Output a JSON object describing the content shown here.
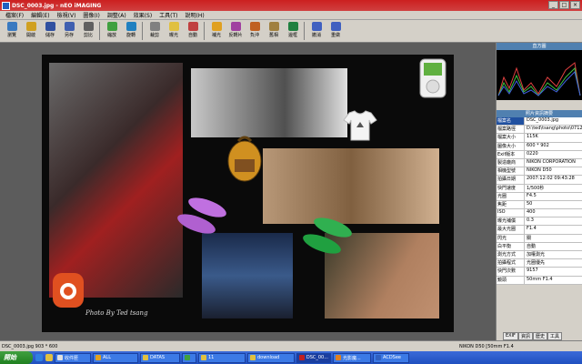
{
  "window": {
    "title": "DSC_0003.jpg - nEO iMAGING"
  },
  "menu": [
    "檔案(F)",
    "編輯(E)",
    "檢視(V)",
    "圖像(I)",
    "調整(A)",
    "效果(S)",
    "工具(T)",
    "說明(H)"
  ],
  "toolbar": [
    {
      "label": "瀏覽",
      "color": "#3a7ac0"
    },
    {
      "label": "開啟",
      "color": "#d0a020"
    },
    {
      "label": "儲存",
      "color": "#3050a0"
    },
    {
      "label": "另存",
      "color": "#4060b0"
    },
    {
      "label": "剪比",
      "color": "#606060"
    },
    {
      "label": "縮放",
      "color": "#40a040"
    },
    {
      "label": "旋轉",
      "color": "#2080c0"
    },
    {
      "label": "裁剪",
      "color": "#808080"
    },
    {
      "label": "曝光",
      "color": "#e0c040"
    },
    {
      "label": "自動",
      "color": "#c04040"
    },
    {
      "label": "補光",
      "color": "#e0a020"
    },
    {
      "label": "反轉片",
      "color": "#a040a0"
    },
    {
      "label": "負沖",
      "color": "#c06020"
    },
    {
      "label": "舊相",
      "color": "#a08040"
    },
    {
      "label": "邊框",
      "color": "#208040"
    },
    {
      "label": "撤消",
      "color": "#4060c0"
    },
    {
      "label": "重做",
      "color": "#4060c0"
    }
  ],
  "canvas": {
    "photo_credit": "Photo By Ted tsang"
  },
  "panel": {
    "histogram_title": "直方圖",
    "info_title": "照片資訊摘要",
    "rows": [
      [
        "檔案名",
        "DSC_0003.jpg"
      ],
      [
        "檔案路徑",
        "D:\\ted\\tsang\\photo\\071202"
      ],
      [
        "檔案大小",
        "115K"
      ],
      [
        "圖像大小",
        "600 * 902"
      ],
      [
        "Exif版本",
        "0220"
      ],
      [
        "製造廠商",
        "NIKON CORPORATION"
      ],
      [
        "相機型號",
        "NIKON D50"
      ],
      [
        "拍攝日期",
        "2007:12:02 09:43:28"
      ],
      [
        "快門速度",
        "1/500秒"
      ],
      [
        "光圈",
        "F4.5"
      ],
      [
        "焦距",
        "50"
      ],
      [
        "ISO",
        "400"
      ],
      [
        "曝光補償",
        "0.3"
      ],
      [
        "最大光圈",
        "F1.4"
      ],
      [
        "閃光",
        "關"
      ],
      [
        "白平衡",
        "自動"
      ],
      [
        "測光方式",
        "加權測光"
      ],
      [
        "拍攝程式",
        "光圈優先"
      ],
      [
        "快門次數",
        "9157"
      ],
      [
        "鏡頭",
        "50mm F1.4"
      ]
    ],
    "tabs": [
      "EXIF",
      "資訊",
      "歷史",
      "工具"
    ]
  },
  "status": {
    "left": "DSC_0003.jpg  903 * 600",
    "right": "NIKON D50 [50mm F1.4"
  },
  "taskbar": {
    "start": "開始",
    "tasks": [
      {
        "label": "收件匣",
        "color": "#e0e0e0"
      },
      {
        "label": "ALL",
        "color": "#e0a020"
      },
      {
        "label": "DATAS",
        "color": "#e0c040"
      },
      {
        "label": "",
        "color": "#40a040"
      },
      {
        "label": "11",
        "color": "#e0c040"
      },
      {
        "label": "download",
        "color": "#e0c040"
      },
      {
        "label": "DSC_00...",
        "color": "#c02020"
      },
      {
        "label": "光影魔...",
        "color": "#e08020"
      },
      {
        "label": "ACDSee",
        "color": "#3060c0"
      }
    ]
  }
}
